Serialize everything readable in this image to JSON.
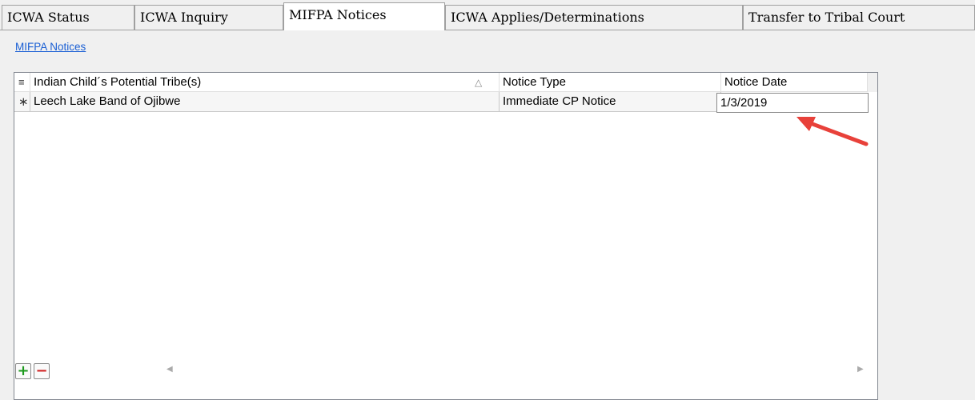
{
  "tabs": [
    {
      "label": "ICWA Status"
    },
    {
      "label": "ICWA Inquiry"
    },
    {
      "label": "MIFPA Notices",
      "active": true
    },
    {
      "label": "ICWA Applies/Determinations"
    },
    {
      "label": "Transfer to Tribal Court"
    }
  ],
  "section_link": "MIFPA Notices",
  "grid": {
    "columns": [
      "Indian Child´s Potential Tribe(s)",
      "Notice Type",
      "Notice Date"
    ],
    "rows": [
      {
        "tribe": "Leech Lake Band of Ojibwe",
        "notice_type": "Immediate CP Notice",
        "notice_date": "1/3/2019"
      }
    ]
  },
  "icons": {
    "column_chooser": "grid-menu-icon",
    "new_row": "asterisk-icon",
    "sort": "sort-ascending-icon",
    "add": "plus-icon",
    "remove": "minus-icon"
  },
  "colors": {
    "link": "#1a5fd4",
    "add_button": "#1e9a1e",
    "remove_button": "#d02020",
    "annotation_arrow": "#e8413a"
  }
}
